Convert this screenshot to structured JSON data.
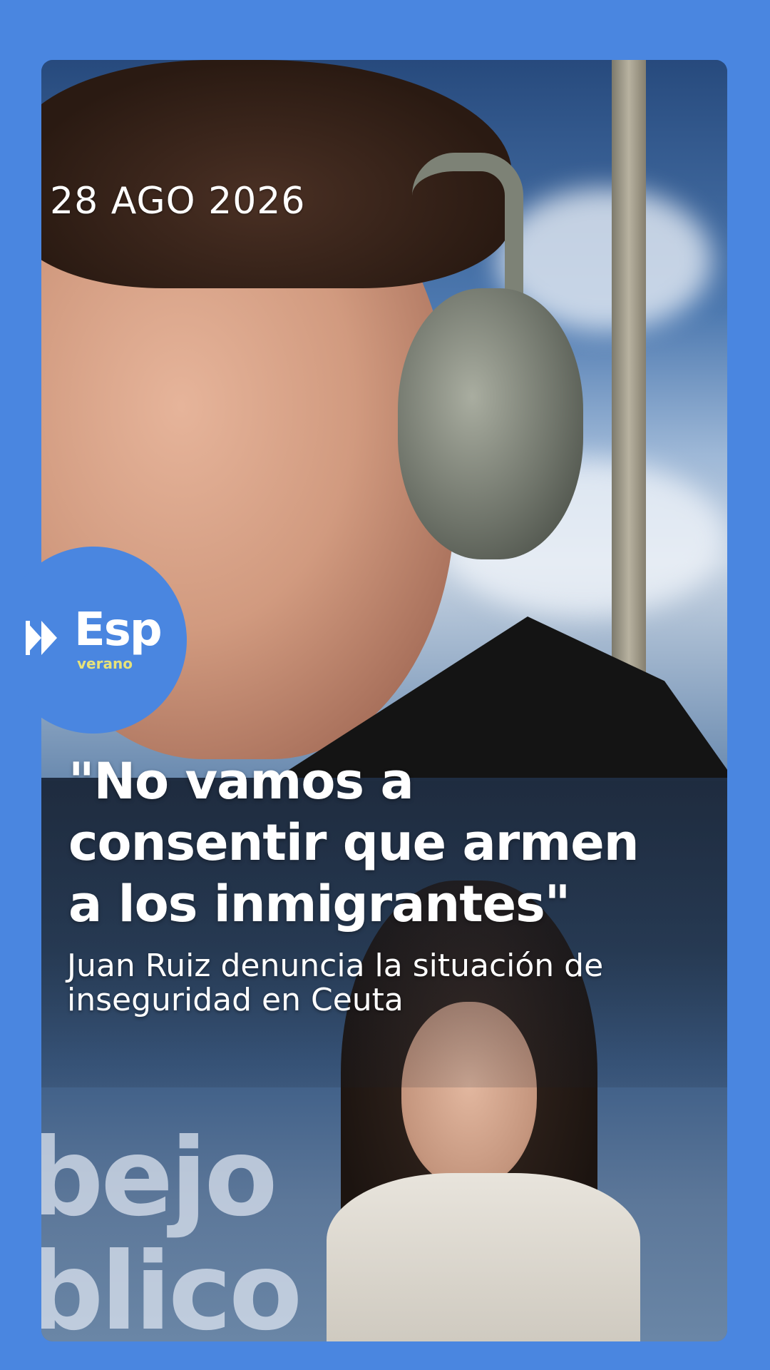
{
  "story": {
    "date": "28 AGO 2026",
    "headline": "\"No vamos a consentir que armen a los inmigrantes\"",
    "headline_lines": [
      "\"No vamos a",
      "consentir que armen",
      "a los inmigrantes\""
    ],
    "subline": "Juan Ruiz denuncia la situación de inseguridad en Ceuta",
    "subline_lines": [
      "Juan Ruiz denuncia la situación de",
      "inseguridad en Ceuta"
    ]
  },
  "logo": {
    "icon": "double-play-icon",
    "name": "Esp",
    "tag": "verano"
  },
  "background_text": {
    "line1": "bejo",
    "line2": "blico"
  },
  "colors": {
    "page_background": "#4a86e0",
    "logo_background": "#4a86e0",
    "logo_tag": "#e6e27a",
    "text": "#ffffff"
  }
}
